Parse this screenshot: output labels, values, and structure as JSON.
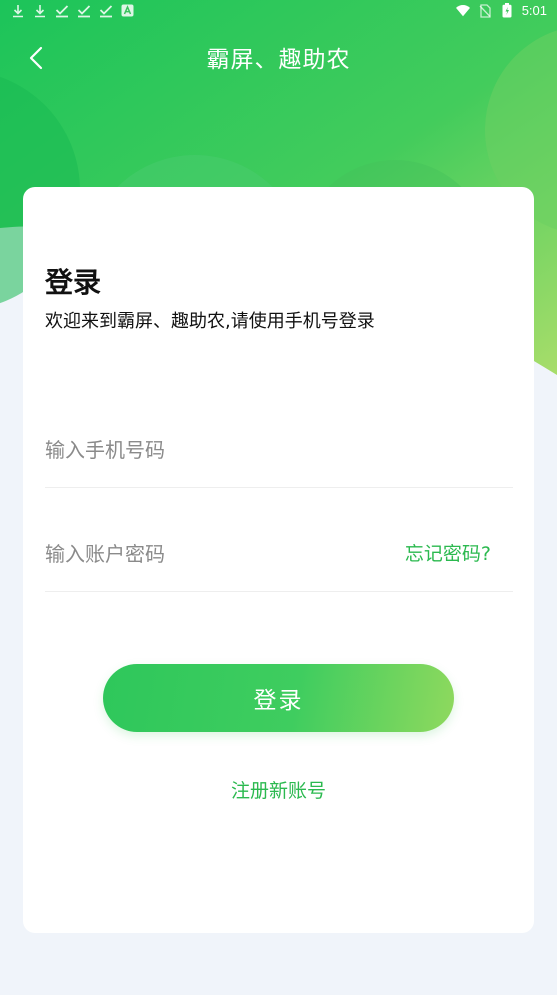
{
  "colors": {
    "accent": "#2bb94f",
    "hero_start": "#1fc45a",
    "hero_end": "#a6dc6a",
    "page_bg": "#f0f4fa",
    "card_bg": "#ffffff"
  },
  "status_bar": {
    "time": "5:01",
    "left_icons": [
      "download-icon",
      "download-icon",
      "check-icon",
      "check-icon",
      "check-icon",
      "a-badge-icon"
    ],
    "right_icons": [
      "wifi-icon",
      "no-sim-icon",
      "battery-icon"
    ]
  },
  "header": {
    "title": "霸屏、趣助农",
    "back_icon": "chevron-left-icon"
  },
  "login": {
    "heading": "登录",
    "subtitle": "欢迎来到霸屏、趣助农,请使用手机号登录",
    "phone_placeholder": "输入手机号码",
    "password_placeholder": "输入账户密码",
    "forgot_label": "忘记密码?",
    "submit_label": "登录",
    "register_label": "注册新账号"
  }
}
